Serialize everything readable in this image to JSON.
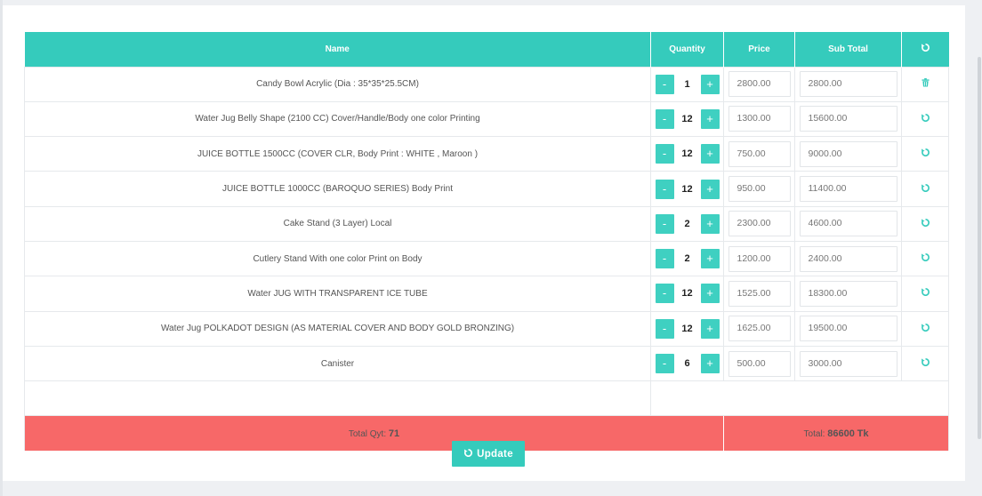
{
  "table": {
    "headers": {
      "name": "Name",
      "quantity": "Quantity",
      "price": "Price",
      "subtotal": "Sub Total",
      "action_icon": "refresh-icon"
    },
    "rows": [
      {
        "name": "Candy Bowl Acrylic (Dia : 35*35*25.5CM)",
        "qty": "1",
        "price": "2800.00",
        "subtotal": "2800.00",
        "action": "trash-icon"
      },
      {
        "name": "Water Jug Belly Shape (2100 CC) Cover/Handle/Body one color Printing",
        "qty": "12",
        "price": "1300.00",
        "subtotal": "15600.00",
        "action": "refresh-icon"
      },
      {
        "name": "JUICE BOTTLE 1500CC (COVER CLR, Body Print : WHITE , Maroon )",
        "qty": "12",
        "price": "750.00",
        "subtotal": "9000.00",
        "action": "refresh-icon"
      },
      {
        "name": "JUICE BOTTLE 1000CC (BAROQUO SERIES) Body Print",
        "qty": "12",
        "price": "950.00",
        "subtotal": "11400.00",
        "action": "refresh-icon"
      },
      {
        "name": "Cake Stand (3 Layer) Local",
        "qty": "2",
        "price": "2300.00",
        "subtotal": "4600.00",
        "action": "refresh-icon"
      },
      {
        "name": "Cutlery Stand With one color Print on Body",
        "qty": "2",
        "price": "1200.00",
        "subtotal": "2400.00",
        "action": "refresh-icon"
      },
      {
        "name": "Water JUG WITH TRANSPARENT ICE TUBE",
        "qty": "12",
        "price": "1525.00",
        "subtotal": "18300.00",
        "action": "refresh-icon"
      },
      {
        "name": "Water Jug POLKADOT DESIGN (AS MATERIAL COVER AND BODY GOLD BRONZING)",
        "qty": "12",
        "price": "1625.00",
        "subtotal": "19500.00",
        "action": "refresh-icon"
      },
      {
        "name": "Canister",
        "qty": "6",
        "price": "500.00",
        "subtotal": "3000.00",
        "action": "refresh-icon"
      }
    ],
    "minus_label": "-",
    "plus_label": "+"
  },
  "totals": {
    "qty_label": "Total Qyt:",
    "qty_value": "71",
    "total_label": "Total:",
    "total_value": "86600",
    "currency": "Tk"
  },
  "update_button": {
    "label": "Update",
    "icon": "refresh-icon"
  },
  "colors": {
    "accent": "#35cbbc",
    "total_bar": "#f76868"
  }
}
